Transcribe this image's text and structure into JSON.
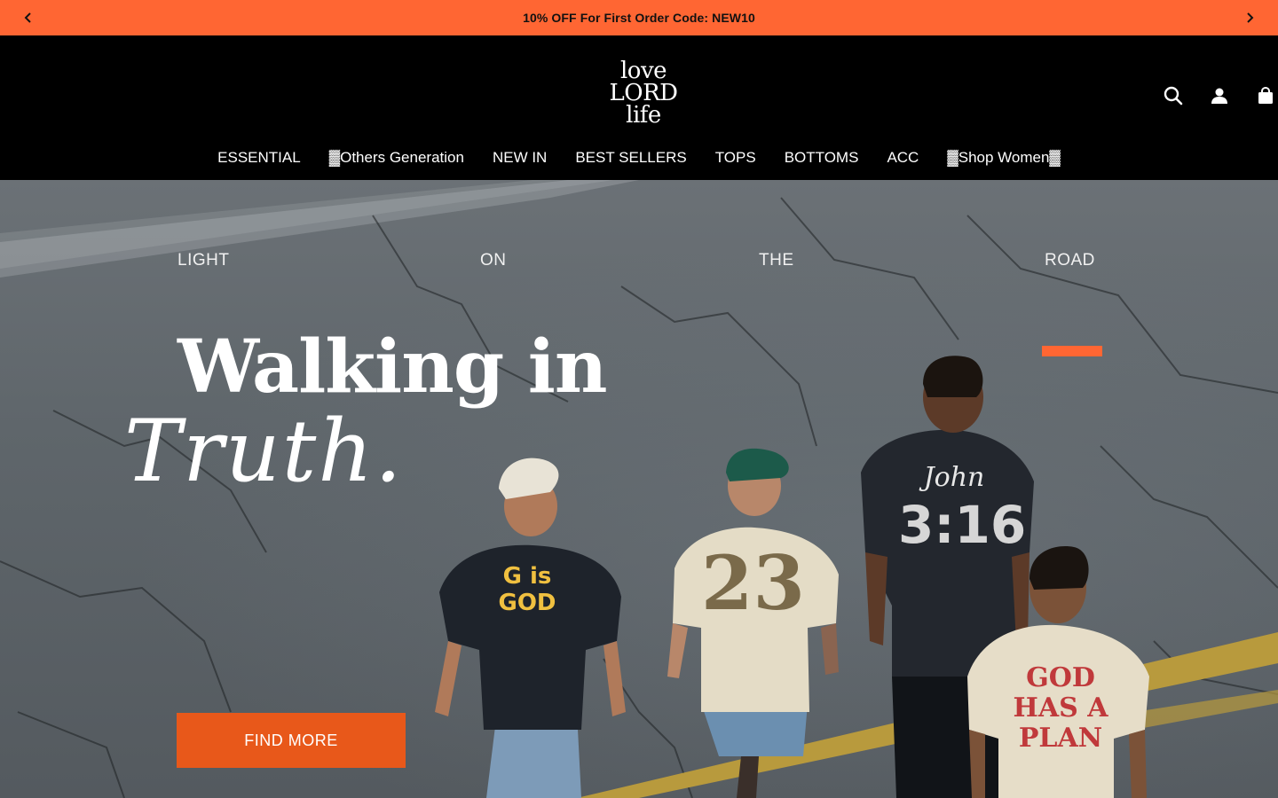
{
  "announcement": {
    "message": "10% OFF For First Order Code: NEW10"
  },
  "header": {
    "logo": [
      "love",
      "LORD",
      "life"
    ],
    "icons": [
      "search-icon",
      "account-icon",
      "cart-icon"
    ]
  },
  "nav": {
    "items": [
      "ESSENTIAL",
      "▓Others Generation",
      "NEW IN",
      "BEST SELLERS",
      "TOPS",
      "BOTTOMS",
      "ACC",
      "▓Shop Women▓"
    ]
  },
  "hero": {
    "words": [
      "LIGHT",
      "ON",
      "THE",
      "ROAD"
    ],
    "headline": "Walking in",
    "script": "Truth.",
    "cta": "FIND MORE",
    "shirts": {
      "one": "G is GOD",
      "two": "23",
      "three_top": "John",
      "three_main": "3:16",
      "four": "GOD HAS A PLAN"
    }
  },
  "colors": {
    "accent": "#ff6633",
    "cta": "#e8581a",
    "header": "#000000"
  }
}
